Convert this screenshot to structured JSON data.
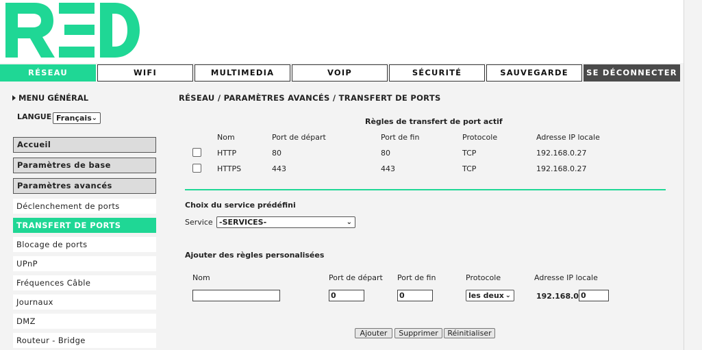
{
  "brand": {
    "logo_text": "RED",
    "color": "#1fd795"
  },
  "nav": {
    "items": [
      "RÉSEAU",
      "WIFI",
      "MULTIMEDIA",
      "VOIP",
      "SÉCURITÉ",
      "SAUVEGARDE"
    ],
    "logout": "SE DÉCONNECTER"
  },
  "sidebar": {
    "menu_general": "MENU GÉNÉRAL",
    "language_label": "LANGUE",
    "language_value": "Français",
    "groups": [
      "Accueil",
      "Paramètres de base",
      "Paramètres avancés"
    ],
    "items": [
      "Déclenchement de ports",
      "TRANSFERT DE PORTS",
      "Blocage de ports",
      "UPnP",
      "Fréquences Câble",
      "Journaux",
      "DMZ",
      "Routeur - Bridge"
    ]
  },
  "breadcrumb": "RÉSEAU / PARAMÈTRES AVANCÉS / TRANSFERT DE PORTS",
  "active_rules": {
    "title": "Règles de transfert de port actif",
    "headers": [
      "Nom",
      "Port de départ",
      "Port de fin",
      "Protocole",
      "Adresse IP locale"
    ],
    "rows": [
      [
        "HTTP",
        "80",
        "80",
        "TCP",
        "192.168.0.27"
      ],
      [
        "HTTPS",
        "443",
        "443",
        "TCP",
        "192.168.0.27"
      ]
    ]
  },
  "predefined": {
    "title": "Choix du service prédéfini",
    "service_label": "Service",
    "service_value": "-SERVICES-"
  },
  "custom": {
    "title": "Ajouter des règles personalisées",
    "headers": [
      "Nom",
      "Port de départ",
      "Port de fin",
      "Protocole",
      "Adresse IP locale"
    ],
    "name_value": "",
    "start_port": "0",
    "end_port": "0",
    "protocol": "les deux",
    "ip_prefix": "192.168.0.",
    "ip_last": "0"
  },
  "buttons": {
    "add": "Ajouter",
    "delete": "Supprimer",
    "reset": "Réinitialiser"
  }
}
